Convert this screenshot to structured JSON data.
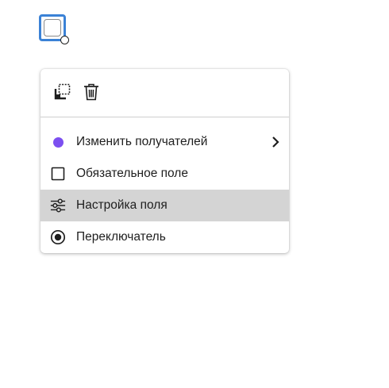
{
  "canvas": {
    "field": {
      "type": "checkbox",
      "selected": true
    }
  },
  "context_menu": {
    "toolbar": [
      {
        "icon": "copy-icon"
      },
      {
        "icon": "trash-icon"
      }
    ],
    "items": [
      {
        "label": "Изменить получателей",
        "icon": "purple-dot-icon",
        "has_submenu": true
      },
      {
        "label": "Обязательное поле",
        "icon": "checkbox-icon"
      },
      {
        "label": "Настройка поля",
        "icon": "sliders-icon",
        "highlighted": true
      },
      {
        "label": "Переключатель",
        "icon": "radio-button-icon"
      }
    ]
  },
  "colors": {
    "selection_border": "#3b82d6",
    "recipient_dot": "#7c4ff0",
    "highlight_bg": "#d4d4d4"
  }
}
